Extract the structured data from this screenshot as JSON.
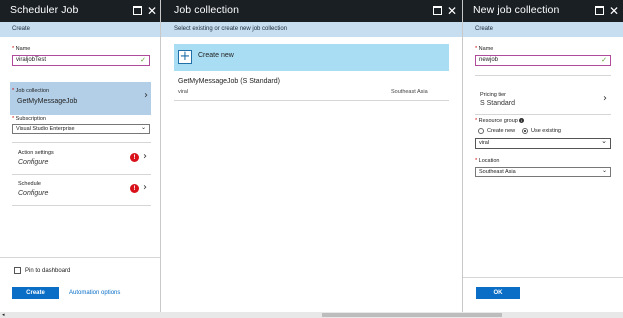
{
  "blade1": {
    "title": "Scheduler Job",
    "subbar": "Create",
    "name": {
      "label": "Name",
      "value": "viraljobTest"
    },
    "job_collection": {
      "label": "Job collection",
      "value": "GetMyMessageJob"
    },
    "subscription": {
      "label": "Subscription",
      "value": "Visual Studio Enterprise"
    },
    "action_settings": {
      "label": "Action settings",
      "value": "Configure"
    },
    "schedule": {
      "label": "Schedule",
      "value": "Configure"
    },
    "pin_label": "Pin to dashboard",
    "create_label": "Create",
    "automation_label": "Automation options"
  },
  "blade2": {
    "title": "Job collection",
    "subbar": "Select existing or create new job collection",
    "create_new": "Create new",
    "item": {
      "name": "GetMyMessageJob (S Standard)",
      "sub": "viral",
      "region": "Southeast Asia"
    }
  },
  "blade3": {
    "title": "New job collection",
    "subbar": "Create",
    "name": {
      "label": "Name",
      "value": "newjob"
    },
    "pricing": {
      "label": "Pricing tier",
      "value": "S Standard"
    },
    "resource_group": {
      "label": "Resource group",
      "create_new": "Create new",
      "use_existing": "Use existing",
      "value": "viral"
    },
    "location": {
      "label": "Location",
      "value": "Southeast Asia"
    },
    "ok_label": "OK"
  },
  "colors": {
    "header": "#1a1f24",
    "subbar": "#c7def0",
    "accent": "#0a6ec7",
    "selected": "#b3cfe8",
    "create_new_bg": "#a9ddf3",
    "error": "#d8111b"
  }
}
